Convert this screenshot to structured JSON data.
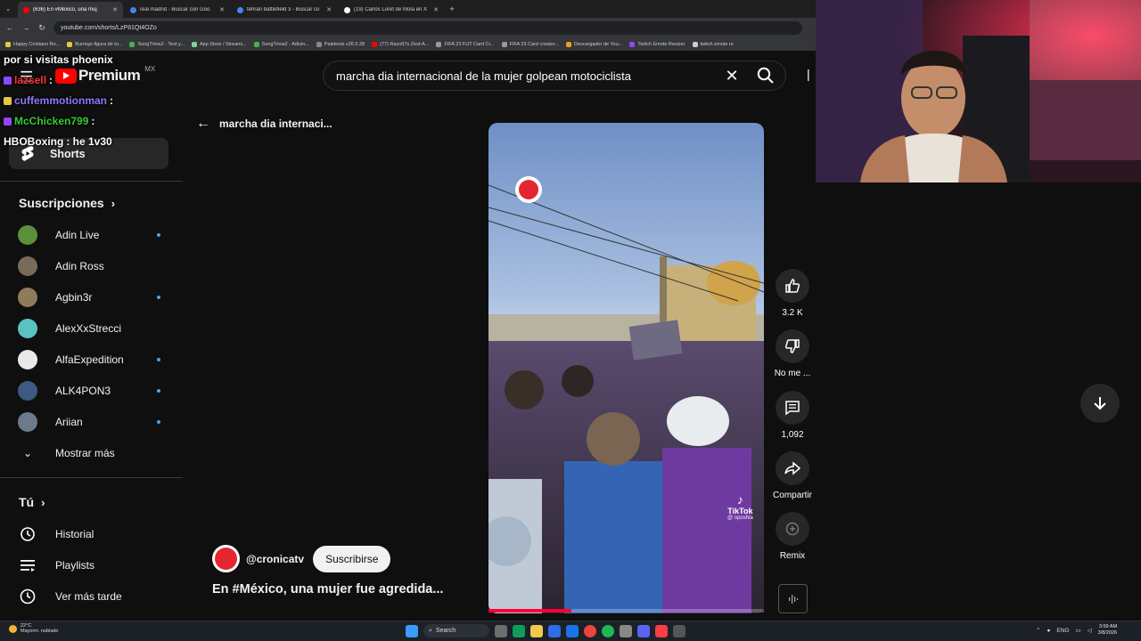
{
  "browser": {
    "tabs": [
      {
        "title": "(636) En #México, una muj",
        "color": "#ff0000",
        "active": true
      },
      {
        "title": "real madrid - Buscar con Goo",
        "color": "#4285f4",
        "active": false
      },
      {
        "title": "tehran battlefield 3 - Buscar co",
        "color": "#4285f4",
        "active": false
      },
      {
        "title": "(19) Carlos Loret de Mola en X",
        "color": "#ffffff",
        "active": false
      }
    ],
    "url": "youtube.com/shorts/LzP81Qt4OZo",
    "bookmarks": [
      {
        "label": "Happy Cristiano Ro...",
        "color": "#e8c547"
      },
      {
        "label": "Burrego figura de to...",
        "color": "#e8c547"
      },
      {
        "label": "SongTrivia2 - Test y...",
        "color": "#4caf50"
      },
      {
        "label": "App Store / Streami...",
        "color": "#7bd3a0"
      },
      {
        "label": "SongTrivia2 - Adivin...",
        "color": "#4caf50"
      },
      {
        "label": "Paletools v26.0.28",
        "color": "#888888"
      },
      {
        "label": "(77) Razo97s Zest-A...",
        "color": "#ff0000"
      },
      {
        "label": "FIFA 23 FUT Card Cr...",
        "color": "#999999"
      },
      {
        "label": "FIFA 23 Card creator...",
        "color": "#999999"
      },
      {
        "label": "Descargador de You...",
        "color": "#f0a020"
      },
      {
        "label": "Twitch Emote Resizer",
        "color": "#9146ff"
      },
      {
        "label": "twitch emote re",
        "color": "#cccccc"
      }
    ]
  },
  "youtube": {
    "logo_text": "Premium",
    "country": "MX",
    "search_value": "marcha dia internacional de la mujer golpean motociclista",
    "back_label": "marcha dia internaci...",
    "sidebar_top": [
      {
        "label": "Shorts",
        "icon": "shorts-icon"
      }
    ],
    "subscriptions_title": "Suscripciones",
    "subscriptions": [
      {
        "name": "Adin Live",
        "live": true,
        "color": "#5a8f3b"
      },
      {
        "name": "Adin Ross",
        "live": false,
        "color": "#7a6a5a"
      },
      {
        "name": "Agbin3r",
        "live": true,
        "color": "#8d7b5c"
      },
      {
        "name": "AlexXxStrecci",
        "live": false,
        "color": "#59c3c3"
      },
      {
        "name": "AlfaExpedition",
        "live": true,
        "color": "#e9e9e9"
      },
      {
        "name": "ALK4PON3",
        "live": true,
        "color": "#3d5a80"
      },
      {
        "name": "Ariian",
        "live": true,
        "color": "#6b7b8c"
      }
    ],
    "show_more": "Mostrar más",
    "you_title": "Tú",
    "you_items": [
      {
        "label": "Historial",
        "icon": "history-icon"
      },
      {
        "label": "Playlists",
        "icon": "playlist-icon"
      },
      {
        "label": "Ver más tarde",
        "icon": "clock-icon"
      }
    ],
    "actions": {
      "like_count": "3.2 K",
      "dislike_label": "No me ...",
      "comments_count": "1,092",
      "share_label": "Compartir",
      "remix_label": "Remix"
    },
    "channel_handle": "@cronicatv",
    "subscribe_label": "Suscribirse",
    "video_title": "En #México, una mujer fue agredida...",
    "progress": 0.3,
    "video_watermark": "TikTok",
    "video_watermark_user": "@ oposhia"
  },
  "chat": [
    {
      "user": "por si visitas phoenix",
      "text": "",
      "color": "#ffffff",
      "badge": ""
    },
    {
      "user": "lazsell",
      "text": ":",
      "color": "#ff3030",
      "badge": "#9146ff"
    },
    {
      "user": "cuffemmotionman",
      "text": ":",
      "color": "#8a7aff",
      "badge": "#e8c547"
    },
    {
      "user": "McChicken799",
      "text": ":",
      "color": "#33cc33",
      "badge": "#9146ff"
    },
    {
      "user": "HBOBoxing",
      "text": ": he 1v30",
      "color": "#ffffff",
      "badge": ""
    }
  ],
  "taskbar": {
    "temperature": "22°C",
    "weather_desc": "Mayorm. nublado",
    "search_label": "Search",
    "lang": "ENG",
    "time": "3:59 AM",
    "date": "3/8/2026"
  }
}
